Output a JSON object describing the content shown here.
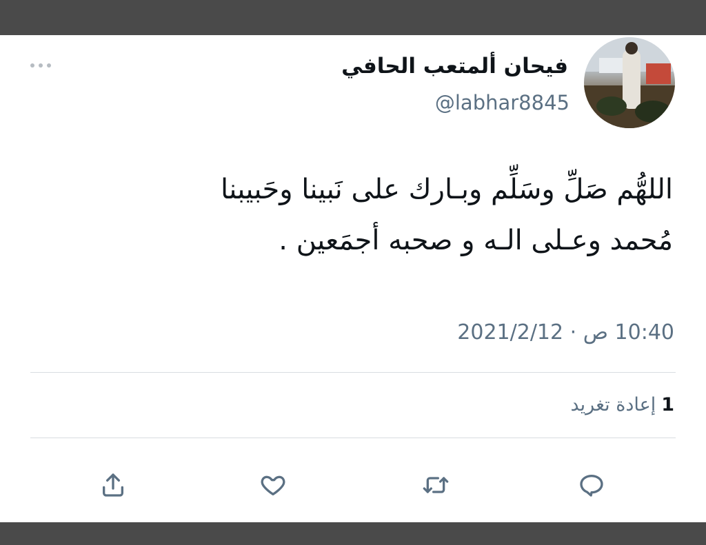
{
  "author": {
    "name": "فيحان ألمتعب الحافي",
    "handle": "@labhar8845"
  },
  "tweet": {
    "text": "اللهُّم صَلِّ وسَلِّم وبـارك على نَبينا وحَبيبنا مُحمد وعـلى الـه و صحبه أجمَعين ."
  },
  "timestamp": "10:40 ص · 2021/2/12",
  "stats": {
    "retweet_count": "1",
    "retweet_label": "إعادة تغريد"
  },
  "icons": {
    "more": "more-icon",
    "share": "share-icon",
    "like": "heart-icon",
    "retweet": "retweet-icon",
    "reply": "reply-icon"
  },
  "colors": {
    "text_primary": "#0f1419",
    "text_secondary": "#5b7083",
    "divider": "#d9dde1",
    "frame": "#4a4a4a"
  }
}
